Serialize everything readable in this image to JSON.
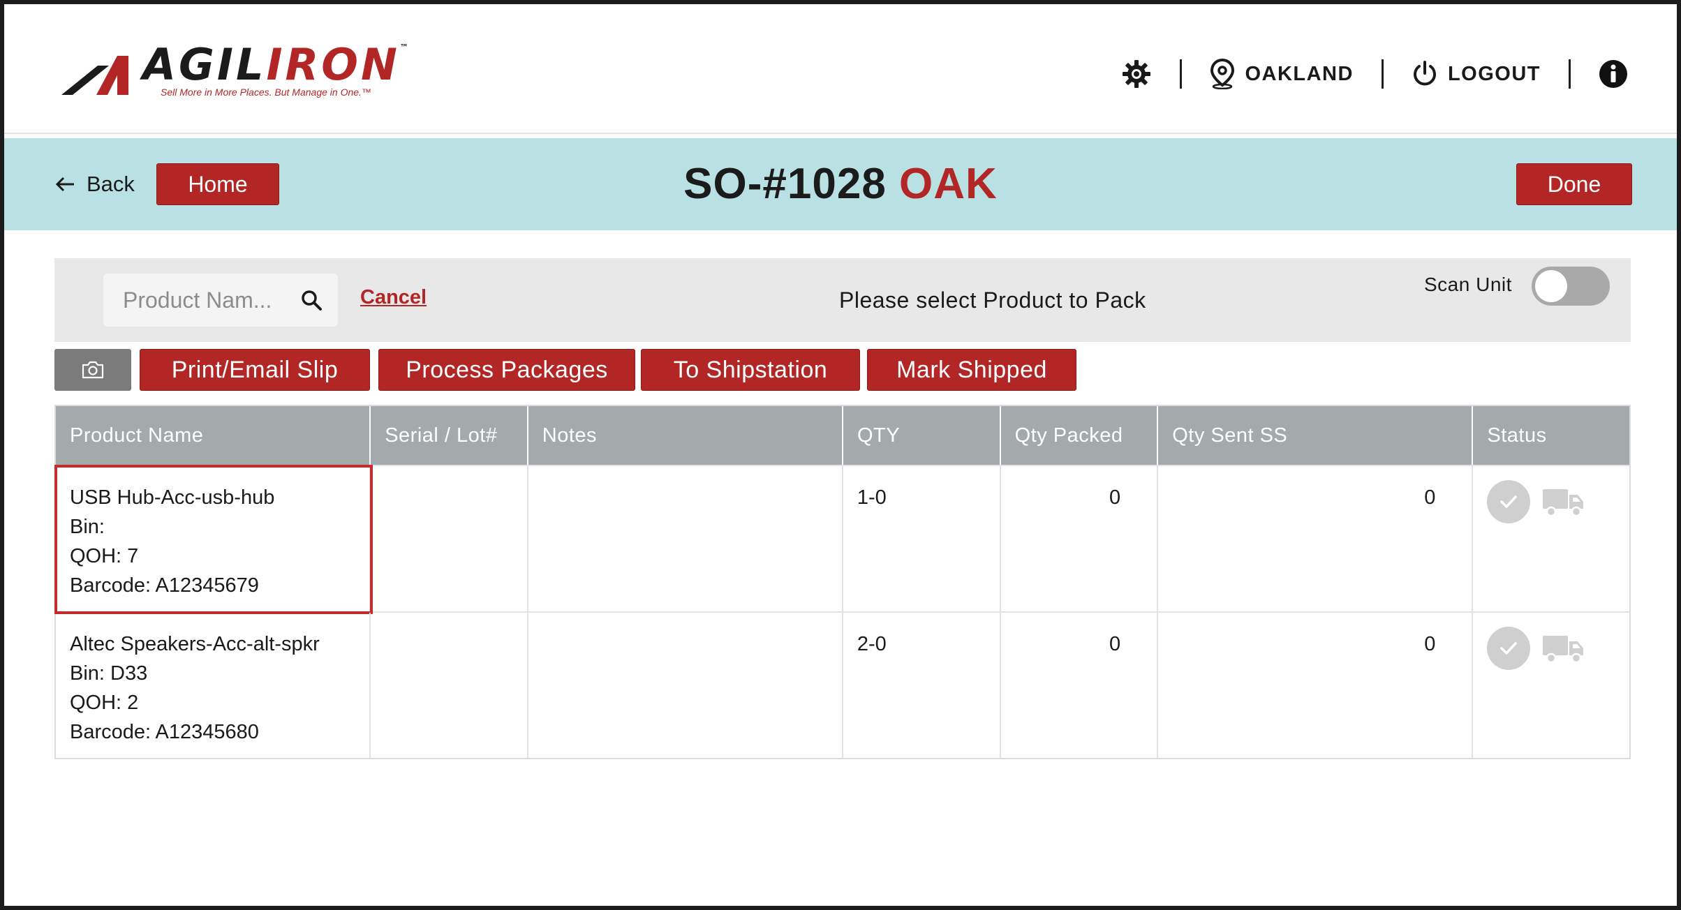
{
  "header": {
    "logo": {
      "brand_a": "AGIL",
      "brand_b": "IRON",
      "tm": "™",
      "tagline": "Sell More in More Places. But Manage in One.™"
    },
    "location": "OAKLAND",
    "logout": "LOGOUT",
    "icons": [
      "gear-icon",
      "location-pin-icon",
      "power-icon",
      "info-icon"
    ]
  },
  "titlebar": {
    "back": "Back",
    "home": "Home",
    "order": "SO-#1028",
    "store": "OAK",
    "done": "Done"
  },
  "search": {
    "placeholder": "Product Nam...",
    "cancel": "Cancel",
    "message": "Please select Product to Pack",
    "scan_unit": "Scan Unit",
    "scan_unit_on": false
  },
  "actions": {
    "print": "Print/Email Slip",
    "process": "Process Packages",
    "shipstation": "To Shipstation",
    "mark_shipped": "Mark Shipped"
  },
  "table": {
    "columns": [
      "Product Name",
      "Serial / Lot#",
      "Notes",
      "QTY",
      "Qty Packed",
      "Qty Sent SS",
      "Status"
    ],
    "rows": [
      {
        "name": "USB Hub-Acc-usb-hub",
        "bin": "Bin:",
        "qoh": "QOH: 7",
        "barcode": "Barcode: A12345679",
        "serial": "",
        "notes": "",
        "qty": "1-0",
        "qty_packed": "0",
        "qty_sent": "0",
        "selected": true
      },
      {
        "name": "Altec Speakers-Acc-alt-spkr",
        "bin": "Bin: D33",
        "qoh": "QOH: 2",
        "barcode": "Barcode: A12345680",
        "serial": "",
        "notes": "",
        "qty": "2-0",
        "qty_packed": "0",
        "qty_sent": "0",
        "selected": false
      }
    ]
  },
  "colors": {
    "accent_red": "#b22726",
    "title_bar": "#b9e1e4",
    "table_header": "#a4aaab"
  }
}
